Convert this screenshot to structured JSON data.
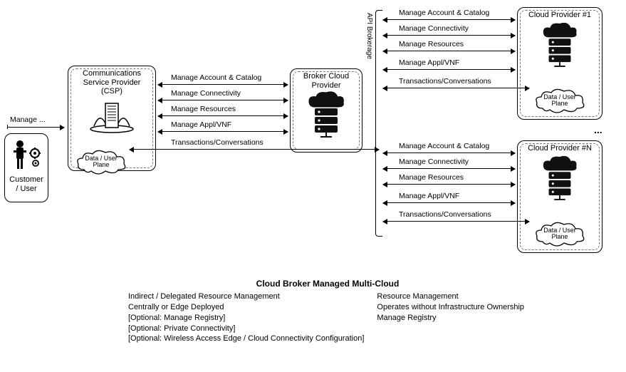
{
  "nodes": {
    "customer": {
      "line1": "Customer",
      "line2": "/ User"
    },
    "csp": {
      "line1": "Communications",
      "line2": "Service Provider",
      "line3": "(CSP)"
    },
    "broker": {
      "line1": "Broker Cloud",
      "line2": "Provider"
    },
    "cp1": {
      "title": "Cloud Provider #1"
    },
    "cpn": {
      "title": "Cloud Provider #N"
    }
  },
  "clouds": {
    "csp": "Data / User\nPlane",
    "cp1": "Data / User\nPlane",
    "cpn": "Data / User\nPlane"
  },
  "manage_label": "Manage ...",
  "api_label": "API Brokerage",
  "ellipsis": "...",
  "links": {
    "csp_broker": [
      "Manage Account & Catalog",
      "Manage Connectivity",
      "Manage Resources",
      "Manage Appl/VNF",
      "Transactions/Conversations"
    ],
    "broker_cp1": [
      "Manage Account & Catalog",
      "Manage Connectivity",
      "Manage Resources",
      "Manage Appl/VNF",
      "Transactions/Conversations"
    ],
    "broker_cpn": [
      "Manage Account & Catalog",
      "Manage Connectivity",
      "Manage Resources",
      "Manage Appl/VNF",
      "Transactions/Conversations"
    ]
  },
  "footer": {
    "title": "Cloud Broker Managed Multi-Cloud",
    "left": [
      "Indirect / Delegated Resource Management",
      "Centrally or Edge Deployed",
      "[Optional: Manage Registry]",
      "[Optional: Private Connectivity]",
      "[Optional: Wireless Access Edge / Cloud Connectivity Configuration]"
    ],
    "right": [
      "Resource Management",
      "Operates without Infrastructure Ownership",
      "Manage Registry"
    ]
  }
}
